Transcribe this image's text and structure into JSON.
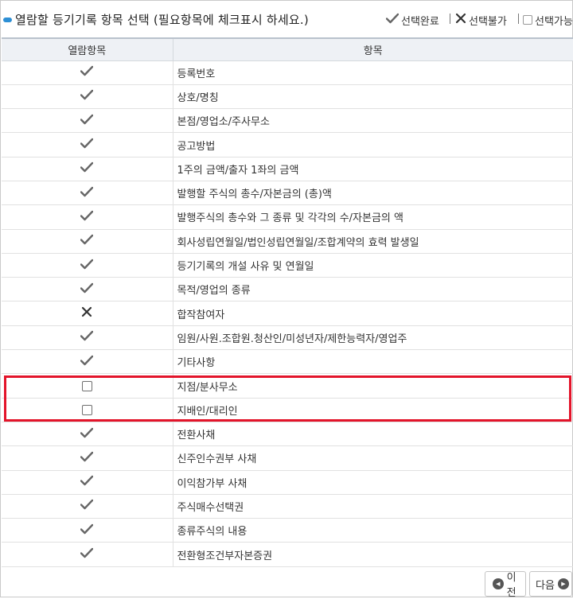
{
  "header": {
    "title": "열람할 등기기록 항목 선택 (필요항목에 체크표시 하세요.)",
    "legend": {
      "selected_done": "선택완료",
      "not_selectable": "선택불가",
      "selectable": "선택가능"
    }
  },
  "table": {
    "columns": [
      "열람항목",
      "항목"
    ],
    "rows": [
      {
        "status": "check",
        "label": "등록번호"
      },
      {
        "status": "check",
        "label": "상호/명칭"
      },
      {
        "status": "check",
        "label": "본점/영업소/주사무소"
      },
      {
        "status": "check",
        "label": "공고방법"
      },
      {
        "status": "check",
        "label": "1주의 금액/출자 1좌의 금액"
      },
      {
        "status": "check",
        "label": "발행할 주식의 총수/자본금의 (총)액"
      },
      {
        "status": "check",
        "label": "발행주식의 총수와 그 종류 및 각각의 수/자본금의 액"
      },
      {
        "status": "check",
        "label": "회사성립연월일/법인성립연월일/조합계약의 효력 발생일"
      },
      {
        "status": "check",
        "label": "등기기록의 개설 사유 및 연월일"
      },
      {
        "status": "check",
        "label": "목적/영업의 종류"
      },
      {
        "status": "x",
        "label": "합작참여자"
      },
      {
        "status": "check",
        "label": "임원/사원.조합원.청산인/미성년자/제한능력자/영업주"
      },
      {
        "status": "check",
        "label": "기타사항"
      },
      {
        "status": "box",
        "label": "지점/분사무소"
      },
      {
        "status": "box",
        "label": "지배인/대리인"
      },
      {
        "status": "check",
        "label": "전환사채"
      },
      {
        "status": "check",
        "label": "신주인수권부 사채"
      },
      {
        "status": "check",
        "label": "이익참가부 사채"
      },
      {
        "status": "check",
        "label": "주식매수선택권"
      },
      {
        "status": "check",
        "label": "종류주식의 내용"
      },
      {
        "status": "check",
        "label": "전환형조건부자본증권"
      }
    ]
  },
  "buttons": {
    "prev": "이전",
    "next": "다음"
  },
  "colors": {
    "accent": "#2d8fd5",
    "highlight": "#e3142a",
    "header_bg": "#eef1f5"
  },
  "icons": {
    "check": "checkmark-icon",
    "x": "x-mark-icon",
    "box": "checkbox-icon"
  }
}
